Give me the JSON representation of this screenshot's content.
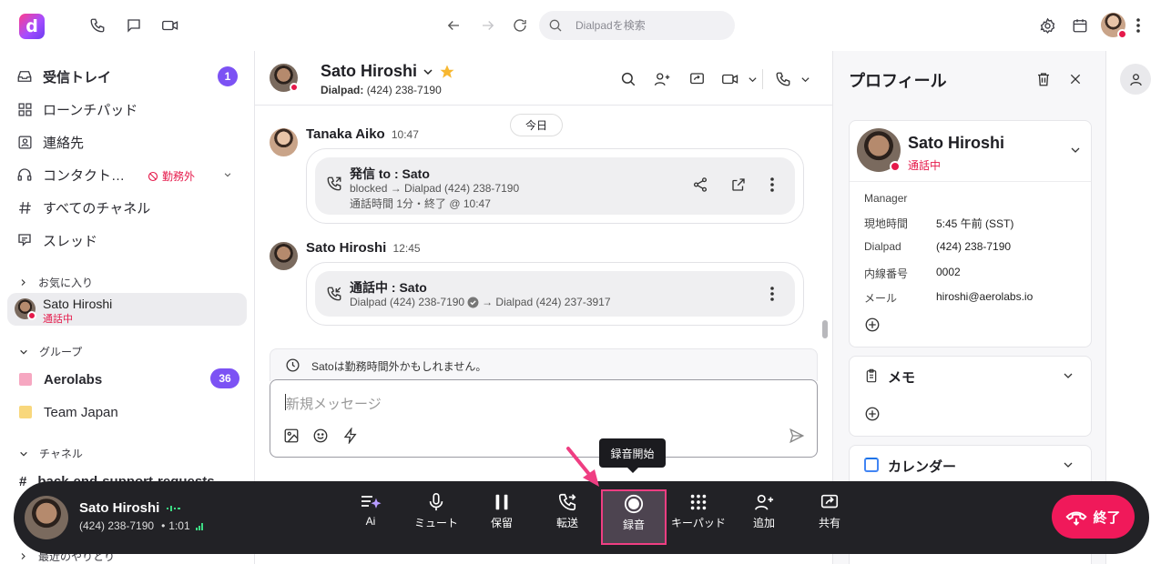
{
  "topbar": {
    "logo_letter": "d",
    "search_placeholder": "Dialpadを検索"
  },
  "sidebar": {
    "inbox": {
      "label": "受信トレイ",
      "count": "1"
    },
    "launchpad": "ローンチパッド",
    "contacts": "連絡先",
    "contact_center": {
      "label": "コンタクト…",
      "status": "勤務外"
    },
    "all_channels": "すべてのチャネル",
    "threads": "スレッド",
    "favorites_header": "お気に入り",
    "favorite_user": {
      "name": "Sato Hiroshi",
      "status": "通話中"
    },
    "groups_header": "グループ",
    "groups": [
      {
        "name": "Aerolabs",
        "count": "36",
        "color": "#f6a7c1"
      },
      {
        "name": "Team Japan",
        "color": "#f8d77c"
      }
    ],
    "channels_header": "チャネル",
    "channel": "back-end-support-requests",
    "recent_header": "最近のやりとり"
  },
  "chat": {
    "contact_name": "Sato Hiroshi",
    "number_label": "Dialpad:",
    "number": "(424) 238-7190",
    "date_pill": "今日",
    "messages": [
      {
        "sender": "Tanaka Aiko",
        "time": "10:47",
        "title": "発信 to : Sato",
        "line1": "blocked → Dialpad (424) 238-7190",
        "line2": "通話時間 1分・終了 @ 10:47"
      },
      {
        "sender": "Sato Hiroshi",
        "time": "12:45",
        "title": "通話中 : Sato",
        "line1a": "Dialpad (424) 238-7190",
        "line1b": "→ Dialpad (424) 237-3917"
      }
    ],
    "notice": "Satoは勤務時間外かもしれません。",
    "composer_placeholder": "新規メッセージ"
  },
  "profile": {
    "title": "プロフィール",
    "name": "Sato Hiroshi",
    "status": "通話中",
    "fields": [
      {
        "key": "Manager",
        "value": ""
      },
      {
        "key": "現地時間",
        "value": "5:45 午前 (SST)"
      },
      {
        "key": "Dialpad",
        "value": "(424) 238-7190"
      },
      {
        "key": "内線番号",
        "value": "0002"
      },
      {
        "key": "メール",
        "value": "hiroshi@aerolabs.io"
      }
    ],
    "memo_title": "メモ",
    "calendar_title": "カレンダー"
  },
  "callbar": {
    "name": "Sato Hiroshi",
    "number": "(424) 238-7190",
    "duration": "1:01",
    "controls": [
      "Ai",
      "ミュート",
      "保留",
      "転送",
      "録音",
      "キーパッド",
      "追加",
      "共有"
    ],
    "end_label": "終了",
    "tooltip": "録音開始"
  },
  "colors": {
    "accent": "#7c52f4",
    "end": "#f0195a",
    "highlight": "#ef3e82",
    "status_red": "#e5194a"
  }
}
